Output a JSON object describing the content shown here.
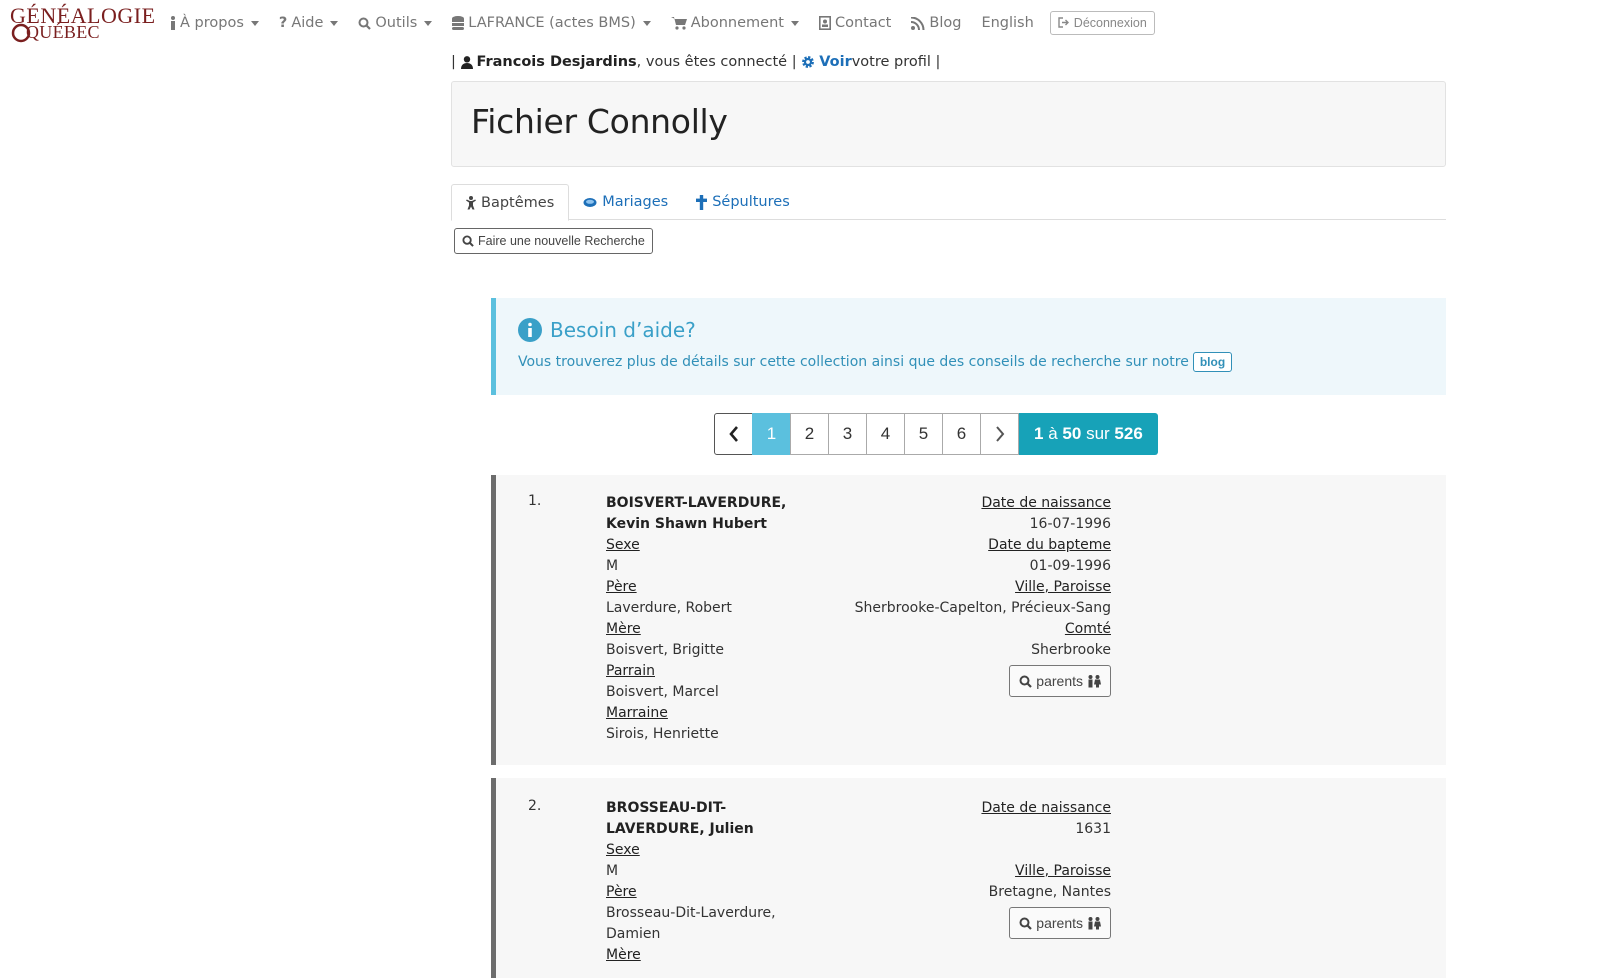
{
  "logo": {
    "line1": "GÉNÉALOGIE",
    "line2": "QUÉBEC"
  },
  "nav": {
    "items": [
      {
        "label": "À propos",
        "icon": "info-icon"
      },
      {
        "label": "Aide",
        "icon": "question-icon"
      },
      {
        "label": "Outils",
        "icon": "search-icon"
      },
      {
        "label": "LAFRANCE (actes BMS)",
        "icon": "database-icon"
      },
      {
        "label": "Abonnement",
        "icon": "cart-icon"
      },
      {
        "label": "Contact",
        "icon": "contact-icon"
      },
      {
        "label": "Blog",
        "icon": "rss-icon"
      },
      {
        "label": "English"
      }
    ],
    "logout_label": "Déconnexion"
  },
  "user": {
    "name": "Francois Desjardins",
    "connected_text": ", vous êtes connecté",
    "view_label": "Voir",
    "profile_text": " votre profil"
  },
  "page_title": "Fichier Connolly",
  "tabs": [
    {
      "label": "Baptêmes",
      "active": true
    },
    {
      "label": "Mariages",
      "active": false
    },
    {
      "label": "Sépultures",
      "active": false
    }
  ],
  "new_search_label": "Faire une nouvelle Recherche",
  "help": {
    "title": "Besoin d’aide?",
    "text": "Vous trouverez plus de détails sur cette collection ainsi que des conseils de recherche sur notre",
    "blog_label": "blog"
  },
  "pagination": {
    "pages": [
      "1",
      "2",
      "3",
      "4",
      "5",
      "6"
    ],
    "current": "1",
    "range_from": "1",
    "range_to": "50",
    "sep": "à",
    "sur": "sur",
    "total": "526"
  },
  "records": [
    {
      "num": "1.",
      "name": "BOISVERT-LAVERDURE, Kevin Shawn Hubert",
      "sexe_label": "Sexe",
      "sexe": "M",
      "pere_label": "Père",
      "pere": "Laverdure, Robert",
      "mere_label": "Mère",
      "mere": "Boisvert, Brigitte",
      "parrain_label": "Parrain",
      "parrain": "Boisvert, Marcel",
      "marraine_label": "Marraine",
      "marraine": "Sirois, Henriette",
      "naissance_label": "Date de naissance",
      "naissance": "16-07-1996",
      "bapteme_label": "Date du bapteme",
      "bapteme": "01-09-1996",
      "ville_label": "Ville, Paroisse",
      "ville": "Sherbrooke-Capelton, Précieux-Sang",
      "comte_label": "Comté",
      "comte": "Sherbrooke",
      "parents_label": "parents"
    },
    {
      "num": "2.",
      "name": "BROSSEAU-DIT-LAVERDURE, Julien",
      "sexe_label": "Sexe",
      "sexe": "M",
      "pere_label": "Père",
      "pere": "Brosseau-Dit-Laverdure, Damien",
      "mere_label": "Mère",
      "naissance_label": "Date de naissance",
      "naissance": "1631",
      "ville_label": "Ville, Paroisse",
      "ville": "Bretagne, Nantes",
      "parents_label": "parents"
    }
  ],
  "colors": {
    "link": "#1d6fb8",
    "info_border": "#5bc0de",
    "info_text": "#3190b8",
    "logo": "#7a1f1f",
    "counter_bg": "#17a2b8"
  }
}
